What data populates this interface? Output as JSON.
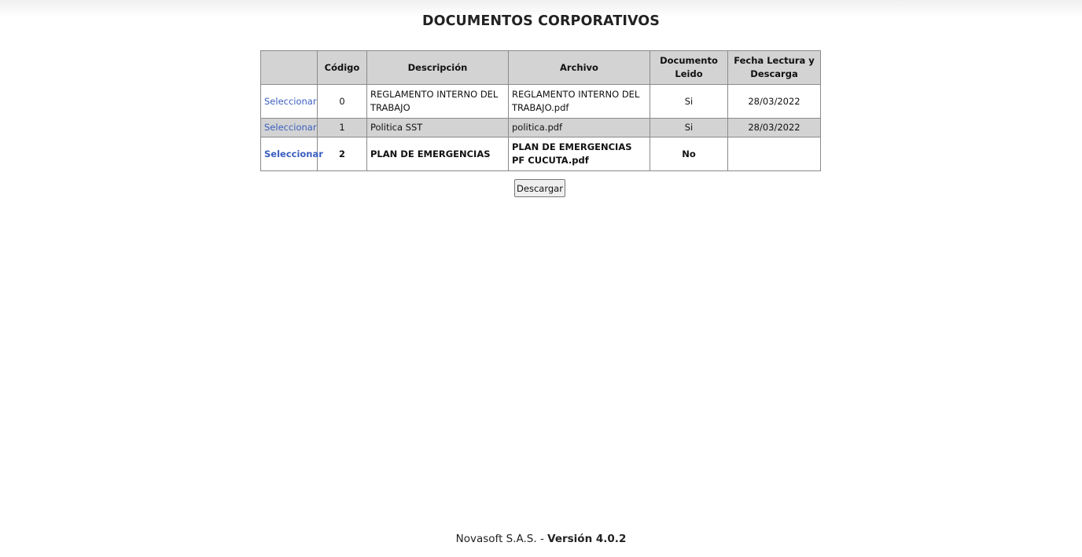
{
  "page": {
    "title": "DOCUMENTOS CORPORATIVOS"
  },
  "table": {
    "headers": {
      "select": "",
      "code": "Código",
      "description": "Descripción",
      "file": "Archivo",
      "read": "Documento Leido",
      "date": "Fecha Lectura y Descarga"
    },
    "rows": [
      {
        "select": "Seleccionar",
        "code": "0",
        "description": "REGLAMENTO INTERNO DEL TRABAJO",
        "file": "REGLAMENTO INTERNO DEL TRABAJO.pdf",
        "read": "Si",
        "date": "28/03/2022"
      },
      {
        "select": "Seleccionar",
        "code": "1",
        "description": "Politica SST",
        "file": "politica.pdf",
        "read": "Si",
        "date": "28/03/2022"
      },
      {
        "select": "Seleccionar",
        "code": "2",
        "description": "PLAN DE EMERGENCIAS",
        "file": "PLAN DE EMERGENCIAS PF CUCUTA.pdf",
        "read": "No",
        "date": ""
      }
    ]
  },
  "actions": {
    "download_label": "Descargar"
  },
  "footer": {
    "company": "Novasoft S.A.S. - ",
    "version": "Versión 4.0.2"
  },
  "colors": {
    "link": "#3b5fbf",
    "header_bg": "#d3d3d3",
    "alt_row_bg": "#d3d3d3",
    "border": "#8a8a8a"
  }
}
